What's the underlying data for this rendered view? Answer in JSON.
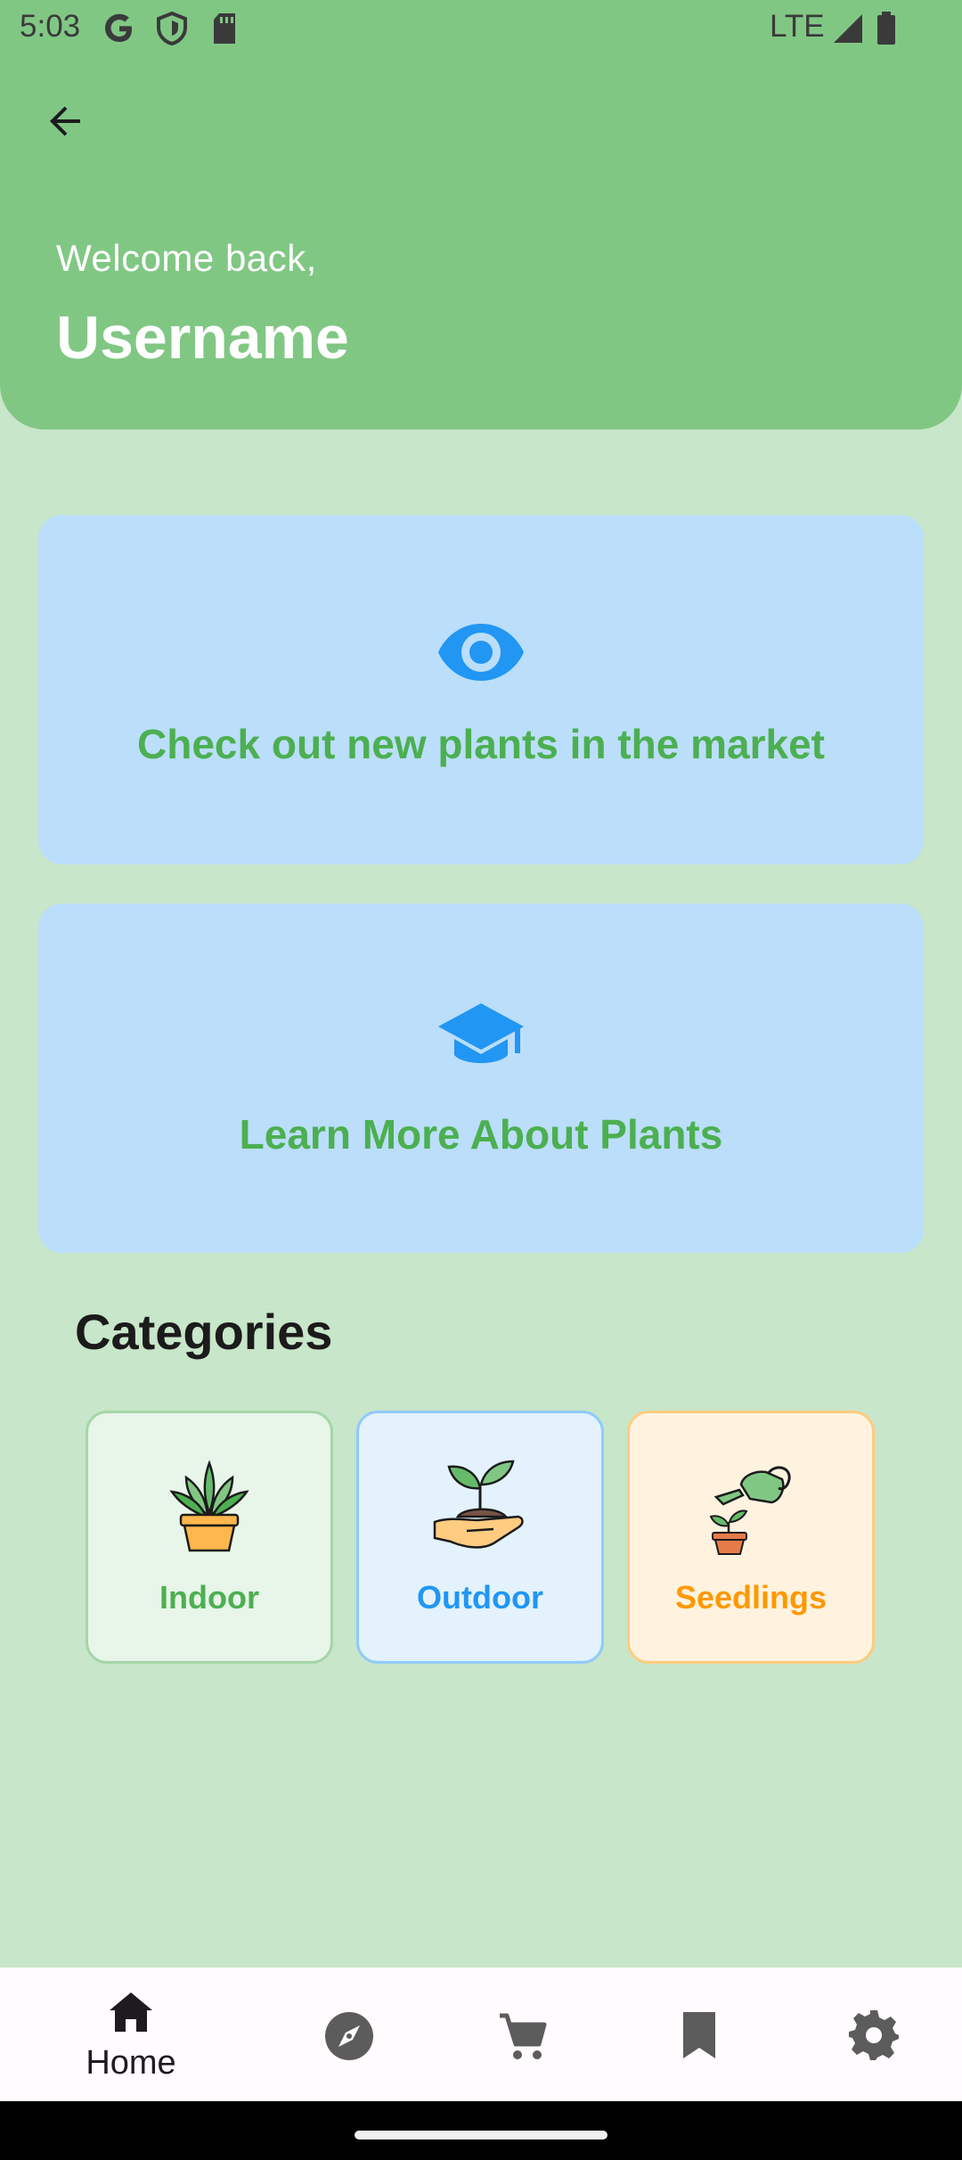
{
  "status_bar": {
    "time": "5:03",
    "network": "LTE",
    "icons": [
      "google-icon",
      "shield-icon",
      "sd-card-icon",
      "signal-icon",
      "battery-icon"
    ]
  },
  "header": {
    "welcome": "Welcome back,",
    "username": "Username",
    "background": "#81c784"
  },
  "cards": {
    "market": {
      "label": "Check out new plants in the market",
      "icon": "eye-icon"
    },
    "learn": {
      "label": "Learn More About Plants",
      "icon": "graduation-cap-icon"
    }
  },
  "categories": {
    "title": "Categories",
    "items": [
      {
        "label": "Indoor",
        "icon": "potted-plant-icon",
        "color": "#4caf50"
      },
      {
        "label": "Outdoor",
        "icon": "sprout-in-hand-icon",
        "color": "#2196f3"
      },
      {
        "label": "Seedlings",
        "icon": "watering-can-icon",
        "color": "#ff9800"
      }
    ]
  },
  "bottom_nav": {
    "items": [
      {
        "label": "Home",
        "icon": "home-icon",
        "selected": true
      },
      {
        "label": "",
        "icon": "compass-icon"
      },
      {
        "label": "",
        "icon": "cart-icon"
      },
      {
        "label": "",
        "icon": "bookmark-icon"
      },
      {
        "label": "",
        "icon": "gear-icon"
      }
    ]
  },
  "colors": {
    "page_background": "#c8e6c9",
    "card_background": "#bbdefb",
    "card_text": "#4caf50",
    "card_icon": "#2196f3"
  }
}
